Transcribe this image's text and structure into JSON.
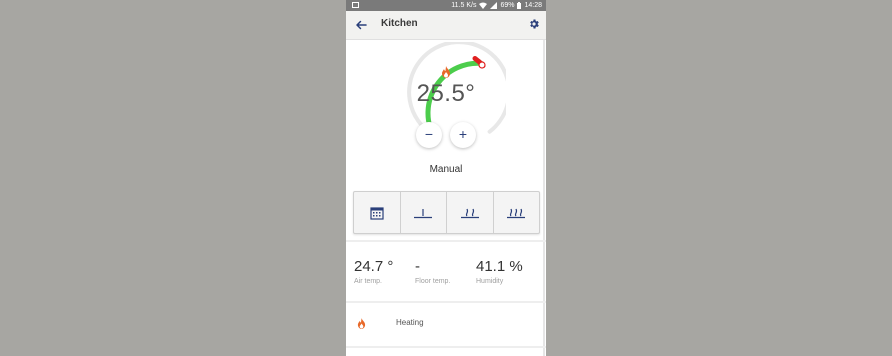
{
  "status_bar": {
    "network_speed": "11.5 K/s",
    "battery": "69%",
    "time": "14:28"
  },
  "header": {
    "title": "Kitchen"
  },
  "thermostat": {
    "setpoint": "25.5°",
    "setpoint_value": 25.5,
    "mode": "Manual",
    "decrease_label": "−",
    "increase_label": "+"
  },
  "stats": {
    "air_temp": {
      "value": "24.7 °",
      "label": "Air temp."
    },
    "floor_temp": {
      "value": "-",
      "label": "Floor temp."
    },
    "humidity": {
      "value": "41.1 %",
      "label": "Humidity"
    }
  },
  "status_row": {
    "label": "Heating"
  },
  "colors": {
    "background": "#a7a6a2",
    "accent_green": "#4ccd4c",
    "accent_red": "#e02020",
    "flame_orange": "#e8692a",
    "icon_blue": "#2a3f7a"
  },
  "icons": {
    "back": "arrow-left-icon",
    "settings": "gear-icon",
    "flame": "flame-icon",
    "schedule": "calendar-icon"
  }
}
